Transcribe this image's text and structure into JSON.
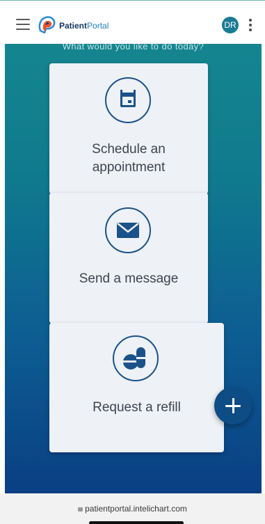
{
  "header": {
    "brand_bold": "Patient",
    "brand_regular": "Portal",
    "avatar_initials": "DR"
  },
  "main": {
    "prompt": "What would you like to do today?",
    "actions": [
      {
        "label_line1": "Schedule an",
        "label_line2": "appointment",
        "icon": "calendar-icon"
      },
      {
        "label_line1": "Send a message",
        "icon": "envelope-icon"
      },
      {
        "label_line1": "Request a refill",
        "icon": "pills-icon"
      }
    ]
  },
  "fab": {
    "icon": "plus-icon"
  },
  "browser": {
    "url": "patientportal.intelichart.com"
  },
  "colors": {
    "accent": "#1a5289",
    "gradient_top": "#15858f",
    "gradient_bottom": "#0a3f83",
    "card": "#eef1f5",
    "avatar": "#1b7b94"
  }
}
